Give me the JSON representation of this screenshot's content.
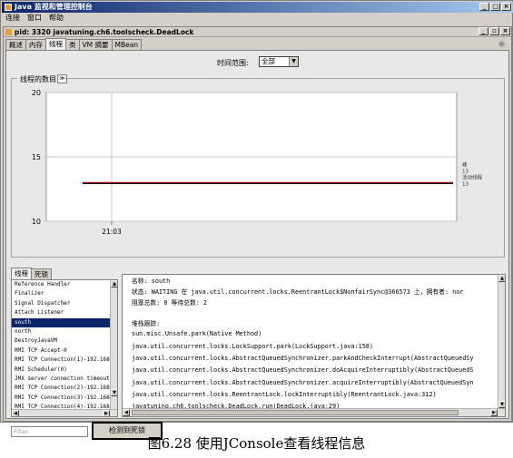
{
  "window": {
    "title": "Java 监视和管理控制台",
    "menu": [
      "连接",
      "窗口",
      "帮助"
    ]
  },
  "inner_window": {
    "title": "pid: 3320 javatuning.ch6.toolscheck.DeadLock"
  },
  "tabs": [
    "概述",
    "内存",
    "线程",
    "类",
    "VM 摘要",
    "MBean"
  ],
  "active_tab": "线程",
  "time_range": {
    "label": "时间范围:",
    "value": "全部"
  },
  "chart": {
    "legend_title": "线程的数目",
    "collapse": "≫",
    "side_labels": [
      "峰",
      "13",
      "活动线程",
      "13"
    ]
  },
  "chart_data": {
    "type": "line",
    "title": "线程的数目",
    "ylim": [
      10,
      20
    ],
    "yticks": [
      10,
      15,
      20
    ],
    "xticks": [
      "21:03"
    ],
    "series": [
      {
        "name": "峰",
        "values": [
          13,
          13
        ],
        "color": "#c00000"
      },
      {
        "name": "活动线程",
        "values": [
          13,
          13
        ],
        "color": "#000000"
      }
    ],
    "grid": true
  },
  "split_tabs": [
    "线程",
    "死锁"
  ],
  "thread_list": [
    "Reference Handler",
    "Finalizer",
    "Signal Dispatcher",
    "Attach Listener",
    "south",
    "north",
    "DestroyJavaVM",
    "RMI TCP Accept-0",
    "RMI TCP Connection(1)-192.168.",
    "RMI Scheduler(0)",
    "JMX server connection timeout",
    "RMI TCP Connection(2)-192.168.",
    "RMI TCP Connection(3)-192.168.",
    "RMI TCP Connection(4)-192.168."
  ],
  "selected_thread": "south",
  "details": [
    "名称:  south",
    "状态: WAITING 在 java.util.concurrent.locks.ReentrantLock$NonfairSync@366573 上，拥有者:  nor",
    "阻塞总数: 0  等待总数:  2",
    "",
    "堆栈跟踪:",
    "sun.misc.Unsafe.park(Native Method)",
    "java.util.concurrent.locks.LockSupport.park(LockSupport.java:158)",
    "java.util.concurrent.locks.AbstractQueuedSynchronizer.parkAndCheckInterrupt(AbstractQueuedSy",
    "java.util.concurrent.locks.AbstractQueuedSynchronizer.doAcquireInterruptibly(AbstractQueuedS",
    "java.util.concurrent.locks.AbstractQueuedSynchronizer.acquireInterruptibly(AbstractQueuedSyn",
    "java.util.concurrent.locks.ReentrantLock.lockInterruptibly(ReentrantLock.java:312)",
    "javatuning.ch6.toolscheck.DeadLock.run(DeadLock.java:29)"
  ],
  "filter_placeholder": "Filter",
  "detect_button": "检测到死锁",
  "caption": "图6.28   使用JConsole查看线程信息"
}
